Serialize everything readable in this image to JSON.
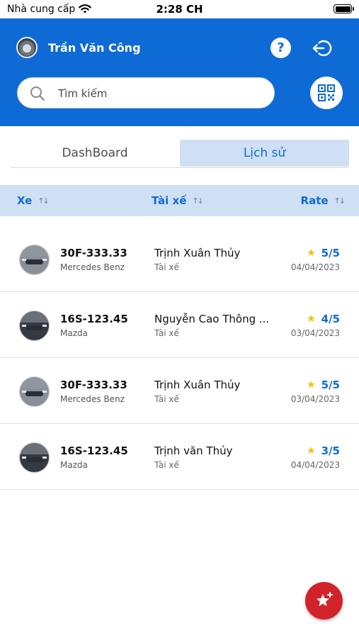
{
  "status_bar": {
    "carrier": "Nhà cung cấp",
    "time": "2:28 CH"
  },
  "header": {
    "user_name": "Trần Văn Công",
    "help_label": "?",
    "search_placeholder": "Tìm kiếm",
    "search_value": "",
    "background_color": "#0e6bd6"
  },
  "tabs": [
    {
      "label": "DashBoard",
      "active": false
    },
    {
      "label": "Lịch sử",
      "active": true
    }
  ],
  "table": {
    "columns": {
      "car": "Xe",
      "driver": "Tài xế",
      "rate": "Rate"
    },
    "rows": [
      {
        "plate": "30F-333.33",
        "model": "Mercedes Benz",
        "driver": "Trịnh Xuân Thủy",
        "role": "Tài xế",
        "rating": "5/5",
        "date": "04/04/2023"
      },
      {
        "plate": "16S-123.45",
        "model": "Mazda",
        "driver": "Nguyễn Cao Thông ...",
        "role": "Tài xế",
        "rating": "4/5",
        "date": "03/04/2023"
      },
      {
        "plate": "30F-333.33",
        "model": "Mercedes Benz",
        "driver": "Trịnh Xuân Thủy",
        "role": "Tài xế",
        "rating": "5/5",
        "date": "03/04/2023"
      },
      {
        "plate": "16S-123.45",
        "model": "Mazda",
        "driver": "Trịnh văn Thủy",
        "role": "Tài xế",
        "rating": "3/5",
        "date": "04/04/2023"
      }
    ]
  },
  "icons": {
    "wifi": "wifi-icon",
    "battery": "battery-icon",
    "help": "help-icon",
    "logout": "logout-icon",
    "search": "search-icon",
    "qr": "qr-code-icon",
    "sort": "sort-icon",
    "star": "star-icon",
    "fab": "add-rating-icon"
  },
  "colors": {
    "accent": "#0e6bd6",
    "star": "#f2c200",
    "fab": "#d2232a",
    "header_row": "#cfe0f4"
  }
}
